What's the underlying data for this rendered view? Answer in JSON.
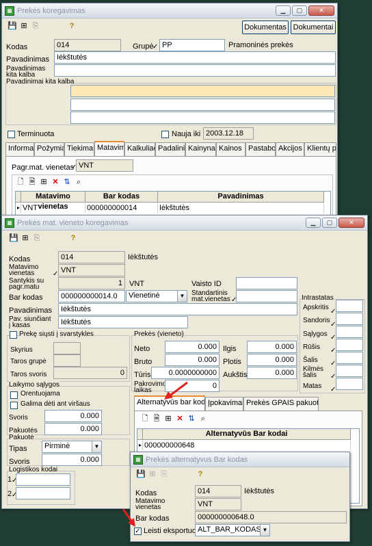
{
  "win1": {
    "title": "Prekės koregavimas",
    "btn_dokumentas": "Dokumentas",
    "btn_dokumentai": "Dokumentai",
    "kodas_label": "Kodas",
    "kodas_value": "014",
    "grupe_label": "Grupė",
    "grupe_value": "PP",
    "grupe_name": "Pramoninės prekės",
    "pavadinimas_label": "Pavadinimas",
    "pavadinimas_value": "Iėkštutės",
    "pav_kita_label_1": "Pavadinimas",
    "pav_kita_label_2": "kita kalba",
    "pav_kita_group": "Pavadinimai kita kalba",
    "terminuota_label": "Terminuota",
    "nauja_iki_label": "Nauja iki",
    "nauja_iki_value": "2003.12.18",
    "tabs": [
      "Informac",
      "Požymiai",
      "Tiekimas",
      "Matavima",
      "Kalkuliac",
      "Padalinia",
      "Kainynas",
      "Kainos",
      "Pastabos",
      "Akcijos",
      "Klientų pr"
    ],
    "pagr_label": "Pagr.mat. vienetas",
    "pagr_value": "VNT",
    "grid_headers": [
      "Matavimo vienetas",
      "Bar kodas",
      "Pavadinimas"
    ],
    "grid_row": [
      "VNT",
      "000000000014",
      "Iėkštutės"
    ]
  },
  "win2": {
    "title": "Prekės mat. vieneto koregavimas",
    "kodas_label": "Kodas",
    "kodas_value": "014",
    "kodas_name": "Iėkštutės",
    "matv_label_1": "Matavimo",
    "matv_label_2": "vienetas",
    "matv_value": "VNT",
    "sant_label_1": "Santykis su",
    "sant_label_2": "pagr.matu",
    "sant_value": "1",
    "sant_unit": "VNT",
    "vaisto_label": "Vaisto ID",
    "barkodas_label": "Bar kodas",
    "barkodas_value": "000000000014.0",
    "barkodas_type": "Vienetinė",
    "std_label_1": "Standartinis",
    "std_label_2": "mat.vienetas",
    "intrastatas_label": "Intrastatas",
    "intrastatas_items": [
      "Apskritis",
      "Sandoris",
      "Sąlygos",
      "Rūšis",
      "Šalis",
      "Kilmės šalis",
      "Matas"
    ],
    "pavadinimas_label": "Pavadinimas",
    "pavadinimas_value": "Iėkštutės",
    "pavsiun_label_1": "Pav. siunčiant",
    "pavsiun_label_2": "į kasas",
    "pavsiun_value": "Iėkštutės",
    "svarstykles_label": "Prekę siųsti į svarstykles",
    "skyrius_label": "Skyrius",
    "taros_grupe_label": "Taros grupė",
    "taros_svoris_label": "Taros svoris",
    "taros_svoris_value": "0",
    "prekes_vieneto_label": "Prekės (vieneto)",
    "neto_label": "Neto",
    "neto_value": "0.000",
    "bruto_label": "Bruto",
    "bruto_value": "0.000",
    "turis_label": "Tūris",
    "turis_value": "0.0000000000",
    "pakrov_label_1": "Pakrovimo",
    "pakrov_label_2": "laikas",
    "pakrov_value": "0",
    "ilgis_label": "Ilgis",
    "ilgis_value": "0.000",
    "plotis_label": "Plotis",
    "plotis_value": "0.000",
    "auksti_label": "Aukštis",
    "auksti_value": "0.000",
    "laikymo_label": "Laikymo sąlygos",
    "orentuojama_label": "Orentuojama",
    "galima_label": "Galima dėti ant viršaus",
    "svoris_label": "Svoris",
    "svoris_value": "0.000",
    "pakuotes_label": "Pakuotės",
    "pakuotes_value": "0.000",
    "pakuote_group": "Pakuotė",
    "tipas_label": "Tipas",
    "tipas_value": "Pirminė",
    "svoris2_label": "Svoris",
    "svoris2_value": "0.000",
    "logistikos_label": "Logistikos kodai",
    "log_1": "1",
    "log_2": "2",
    "tabs": [
      "Alternatyvūs bar kodai",
      "Įpokavimai",
      "Prekės GPAIS pakuotės"
    ],
    "grid_header": "Alternatyvūs Bar kodai",
    "grid_row": "000000000648"
  },
  "win3": {
    "title": "Prekės alternatyvus Bar kodas",
    "kodas_label": "Kodas",
    "kodas_value": "014",
    "kodas_name": "Iėkštutės",
    "matv_label_1": "Matavimo",
    "matv_label_2": "vienetas",
    "matv_value": "VNT",
    "barkodas_label": "Bar kodas",
    "barkodas_value": "000000000648.0",
    "leisti_label": "Leisti eksportuoti",
    "leisti_value": "ALT_BAR_KODAS"
  },
  "colors": {
    "highlight": "#fbe8b4",
    "accent": "#e68b2c",
    "arrow": "#e02020"
  }
}
